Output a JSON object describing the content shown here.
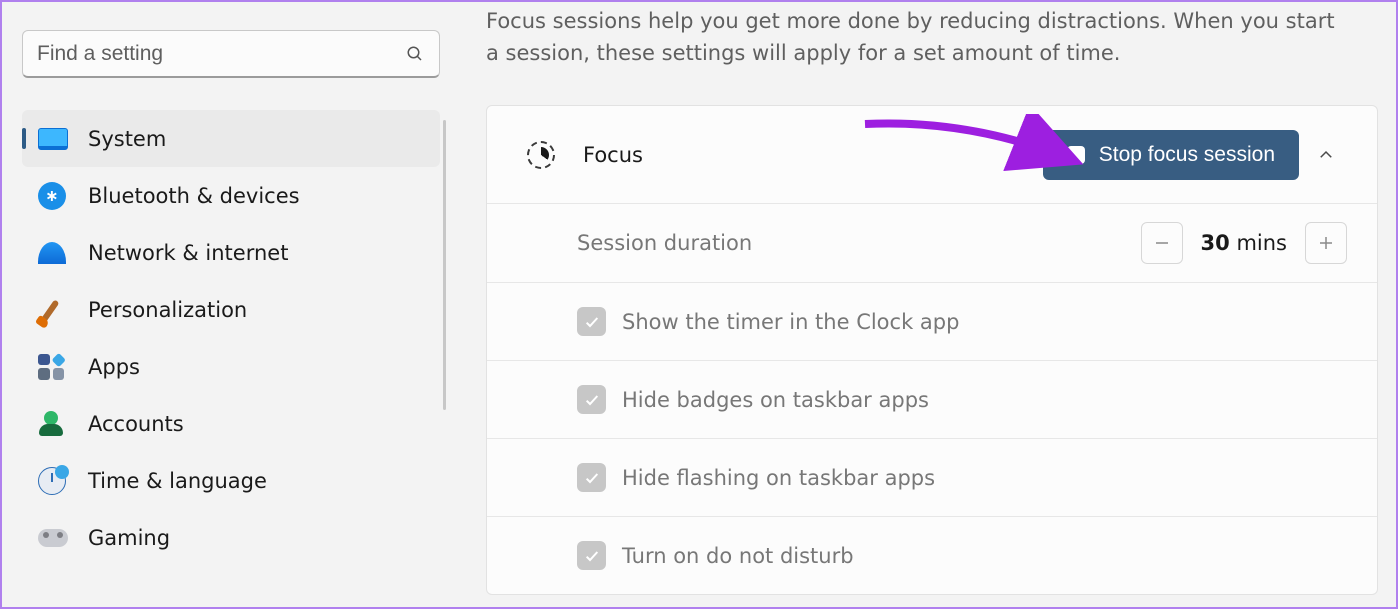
{
  "search": {
    "placeholder": "Find a setting"
  },
  "nav": {
    "items": [
      {
        "key": "system",
        "label": "System"
      },
      {
        "key": "bluetooth",
        "label": "Bluetooth & devices"
      },
      {
        "key": "network",
        "label": "Network & internet"
      },
      {
        "key": "personalization",
        "label": "Personalization"
      },
      {
        "key": "apps",
        "label": "Apps"
      },
      {
        "key": "accounts",
        "label": "Accounts"
      },
      {
        "key": "time-language",
        "label": "Time & language"
      },
      {
        "key": "gaming",
        "label": "Gaming"
      }
    ],
    "active": "system"
  },
  "main": {
    "intro": "Focus sessions help you get more done by reducing distractions. When you start a session, these settings will apply for a set amount of time.",
    "focus": {
      "title": "Focus",
      "button_label": "Stop focus session",
      "expanded": true
    },
    "duration": {
      "label": "Session duration",
      "value": "30",
      "unit": "mins"
    },
    "options": [
      {
        "key": "show-timer",
        "label": "Show the timer in the Clock app",
        "checked": true,
        "enabled": false
      },
      {
        "key": "hide-badges",
        "label": "Hide badges on taskbar apps",
        "checked": true,
        "enabled": false
      },
      {
        "key": "hide-flash",
        "label": "Hide flashing on taskbar apps",
        "checked": true,
        "enabled": false
      },
      {
        "key": "dnd",
        "label": "Turn on do not disturb",
        "checked": true,
        "enabled": false
      }
    ]
  },
  "colors": {
    "accent": "#385d82",
    "annotation": "#9d1fe0"
  }
}
